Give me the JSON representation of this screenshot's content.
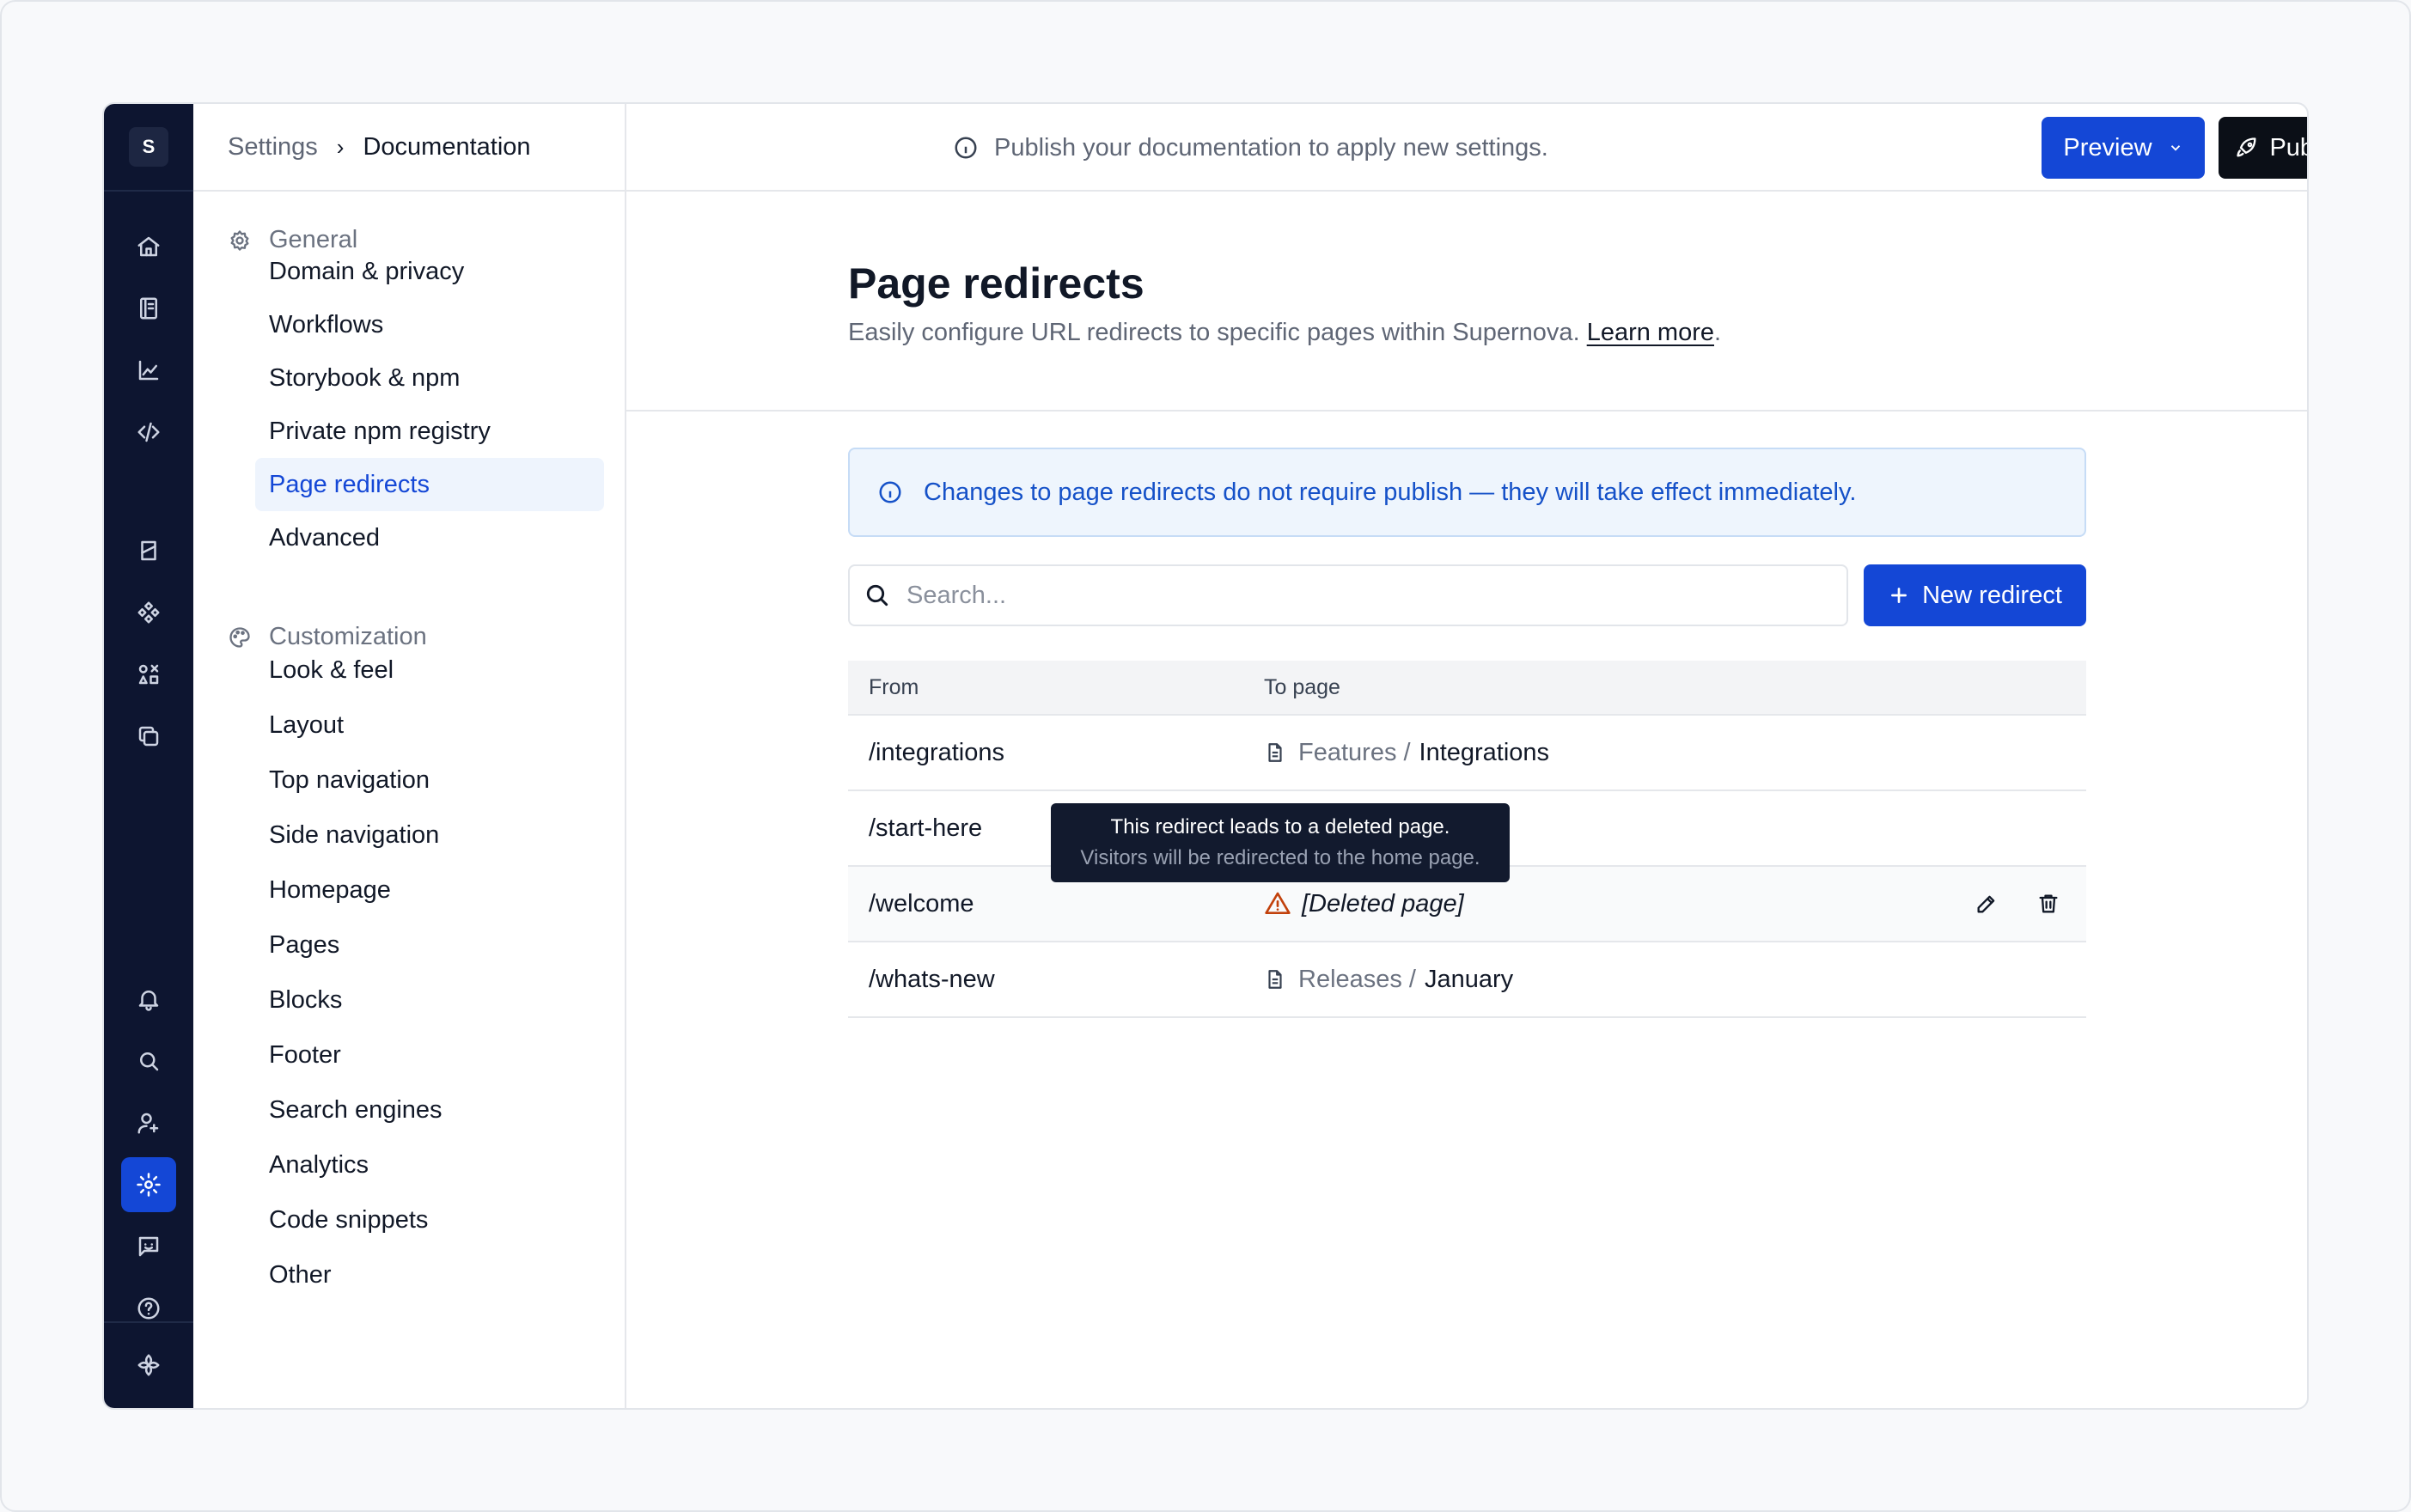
{
  "workspace": {
    "badge": "S"
  },
  "rail": {
    "top_icons": [
      "home-icon",
      "book-icon",
      "analytics-icon",
      "code-icon"
    ],
    "middle_icons": [
      "documentation-icon",
      "components-icon",
      "assets-icon",
      "copy-icon"
    ],
    "bottom_icons": [
      "bell-icon",
      "search-icon",
      "add-user-icon",
      "settings-icon",
      "feedback-icon",
      "help-icon"
    ],
    "logo": "supernova-logo"
  },
  "breadcrumb": {
    "root": "Settings",
    "separator": "›",
    "current": "Documentation"
  },
  "nav": {
    "general": {
      "title": "General",
      "items": [
        "Domain & privacy",
        "Workflows",
        "Storybook & npm",
        "Private npm registry",
        "Page redirects",
        "Advanced"
      ]
    },
    "customization": {
      "title": "Customization",
      "items": [
        "Look & feel",
        "Layout",
        "Top navigation",
        "Side navigation",
        "Homepage",
        "Pages",
        "Blocks",
        "Footer",
        "Search engines",
        "Analytics",
        "Code snippets",
        "Other"
      ]
    },
    "active": "Page redirects"
  },
  "topbar": {
    "message": "Publish your documentation to apply new settings.",
    "preview_label": "Preview",
    "publish_label": "Publish"
  },
  "page": {
    "title": "Page redirects",
    "subtitle": "Easily configure URL redirects to specific pages within Supernova.",
    "learn_more": "Learn more",
    "period": "."
  },
  "banner": {
    "text": "Changes to page redirects do not require publish — they will take effect immediately."
  },
  "search": {
    "placeholder": "Search..."
  },
  "new_redirect_label": "New redirect",
  "table": {
    "headers": {
      "from": "From",
      "to": "To page"
    },
    "rows": [
      {
        "from": "/integrations",
        "parent": "Features",
        "slash": "/",
        "page": "Integrations"
      },
      {
        "from": "/start-here",
        "parent": "",
        "slash": "",
        "page": ""
      },
      {
        "from": "/welcome",
        "deleted": "[Deleted page]"
      },
      {
        "from": "/whats-new",
        "parent": "Releases",
        "slash": "/",
        "page": "January"
      }
    ]
  },
  "tooltip": {
    "line1": "This redirect leads to a deleted page.",
    "line2": "Visitors will be redirected to the home page."
  },
  "colors": {
    "accent": "#1447d6",
    "rail_bg": "#0d1530",
    "warning": "#c2410c",
    "banner_bg": "#eef5fd"
  }
}
